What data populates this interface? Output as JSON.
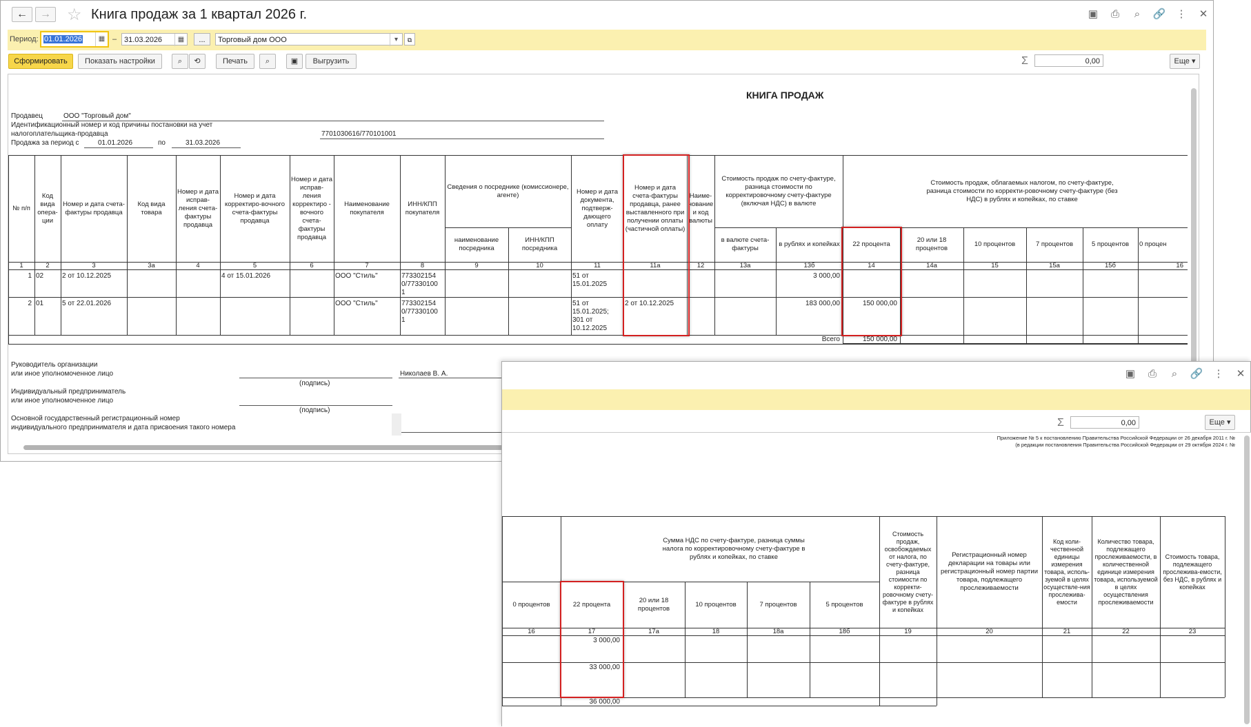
{
  "main_window": {
    "title": "Книга продаж за 1 квартал 2026 г.",
    "nav": {
      "back_icon": "arrow-left-icon",
      "forward_icon": "arrow-right-icon"
    },
    "title_icons": [
      "save-icon",
      "print-icon",
      "preview-icon",
      "link-icon",
      "more-icon",
      "close-icon"
    ],
    "filter": {
      "period_label": "Период:",
      "date_from": "01.01.2026",
      "date_sep": "–",
      "date_to": "31.03.2026",
      "ellipsis": "...",
      "org": "Торговый дом ООО"
    },
    "toolbar": {
      "form_label": "Сформировать",
      "settings_label": "Показать настройки",
      "print_label": "Печать",
      "export_label": "Выгрузить",
      "sum_value": "0,00",
      "more_label": "Еще"
    },
    "report": {
      "title": "КНИГА ПРОДАЖ",
      "seller_label": "Продавец",
      "seller_value": "ООО \"Торговый дом\"",
      "inn_label_1": "Идентификационный номер и код причины постановки на учет",
      "inn_label_2": "налогоплательщика-продавца",
      "inn_value": "7701030616/770101001",
      "period_label": "Продажа за период с",
      "period_from": "01.01.2026",
      "period_to_label": "по",
      "period_to": "31.03.2026",
      "headers": {
        "c1": "№ п/п",
        "c2": "Код вида опера-ции",
        "c3": "Номер и дата счета-фактуры продавца",
        "c3a": "Код вида товара",
        "c4": "Номер и дата исправ-ления счета-фактуры продавца",
        "c5": "Номер и дата корректиро-вочного счета-фактуры продавца",
        "c6": "Номер и дата исправ-ления корректиро - вочного счета-фактуры продавца",
        "c7": "Наименование покупателя",
        "c8": "ИНН/КПП покупателя",
        "c9_10": "Сведения о посреднике (комиссионере, агенте)",
        "c9": "наименование посредника",
        "c10": "ИНН/КПП посредника",
        "c11": "Номер и дата документа, подтверж-дающего оплату",
        "c11a": "Номер и дата счета-фактуры продавца, ранее выставленного при получении оплаты (частичной оплаты)",
        "c12": "Наиме-нование и код валюты",
        "c13": "Стоимость продаж по счету-фактуре, разница стоимости по корректировочному счету-фактуре (включая НДС) в валюте",
        "c13a": "в валюте счета-фактуры",
        "c13b": "в рублях и копейках",
        "c14": "Стоимость продаж, облагаемых налогом, по счету-фактуре, разница стоимости по корректи-ровочному счету-фактуре (без НДС) в рублях и копейках, по ставке",
        "c14s": "22 процента",
        "c14a": "20 или 18 процентов",
        "c15": "10 процентов",
        "c15a": "7 процентов",
        "c15b": "5 процентов",
        "c16": "0 процен"
      },
      "numbers": [
        "1",
        "2",
        "3",
        "3а",
        "4",
        "5",
        "6",
        "7",
        "8",
        "9",
        "10",
        "11",
        "11а",
        "12",
        "13а",
        "13б",
        "14",
        "14а",
        "15",
        "15а",
        "15б",
        "16"
      ],
      "rows": [
        {
          "n": "1",
          "code": "02",
          "invoice": "2 от 10.12.2025",
          "corr": "4 от 15.01.2026",
          "buyer": "ООО \"Стиль\"",
          "inn": "773302154 0/77330100 1",
          "payment": "51 от 15.01.2025",
          "prev": "",
          "rub": "3 000,00",
          "v22": ""
        },
        {
          "n": "2",
          "code": "01",
          "invoice": "5 от 22.01.2026",
          "corr": "",
          "buyer": "ООО \"Стиль\"",
          "inn": "773302154 0/77330100 1",
          "payment": "51 от 15.01.2025; 301 от 10.12.2025",
          "prev": "2 от 10.12.2025",
          "rub": "183 000,00",
          "v22": "150 000,00"
        }
      ],
      "total_label": "Всего",
      "total_22": "150 000,00",
      "sign": {
        "head_1": "Руководитель организации",
        "head_2": "или иное уполномоченное лицо",
        "podpis": "(подпись)",
        "head_name": "Николаев В. А.",
        "ip_1": "Индивидуальный предприниматель",
        "ip_2": "или иное уполномоченное лицо",
        "ogrn_1": "Основной государственный регистрационный номер",
        "ogrn_2": "индивидуального предпринимателя и дата присвоения такого номера"
      }
    }
  },
  "second_window": {
    "title_icons": [
      "save-icon",
      "print-icon",
      "preview-icon",
      "link-icon",
      "more-icon",
      "close-icon"
    ],
    "sum_value": "0,00",
    "more_label": "Еще",
    "report": {
      "note_1": "Приложение № 5 к постановлению Правительства Российской Федерации от 26 декабря 2011 г. №",
      "note_2": "(в редакции постановления Правительства Российской Федерации от 29 октября 2024 г. №",
      "headers": {
        "c17": "Сумма НДС по счету-фактуре, разница суммы налога по корректировочному счету-фактуре в рублях и копейках, по ставке",
        "c16": "0 процентов",
        "c17s": "22 процента",
        "c17a": "20 или 18 процентов",
        "c18": "10 процентов",
        "c18a": "7 процентов",
        "c18b": "5 процентов",
        "c19": "Стоимость продаж, освобождаемых от налога, по счету-фактуре, разница стоимости по корректи-ровочному счету-фактуре в рублях и копейках",
        "c20": "Регистрационный номер декларации на товары или регистрационный номер партии товара, подлежащего прослеживаемости",
        "c21": "Код коли-чественной единицы измерения товара, исполь-зуемой в целях осуществле-ния прослежива-емости",
        "c22": "Количество товара, подлежащего прослеживаемости, в количественной единице измерения товара, используемой в целях осуществления прослеживаемости",
        "c23": "Стоимость товара, подлежащего прослежива-емости, без НДС, в рублях и копейках"
      },
      "numbers": [
        "16",
        "17",
        "17а",
        "18",
        "18а",
        "18б",
        "19",
        "20",
        "21",
        "22",
        "23"
      ],
      "row1_17": "3 000,00",
      "row2_17": "33 000,00",
      "total_17": "36 000,00"
    }
  },
  "colors": {
    "accent_yellow": "#f7d64a",
    "band": "#fbf0b0",
    "highlight_red": "#d32020"
  }
}
